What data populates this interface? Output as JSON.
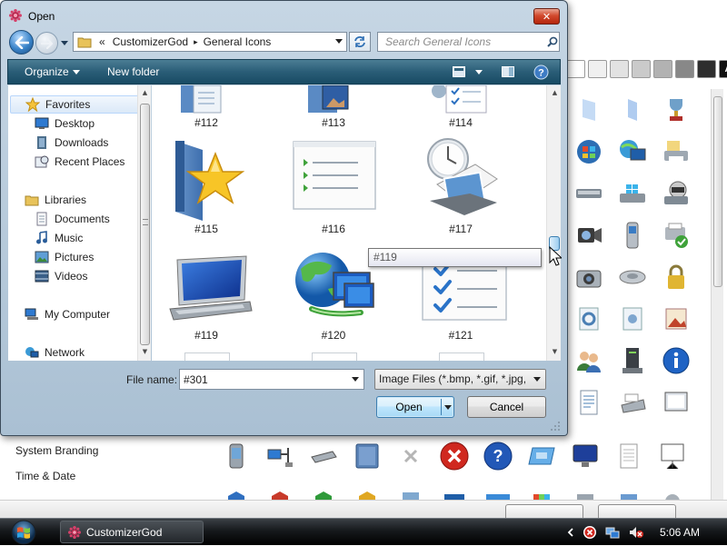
{
  "dialog": {
    "title": "Open",
    "close_label": "✕",
    "breadcrumb": {
      "overflow": "«",
      "parts": [
        "CustomizerGod",
        "General Icons"
      ],
      "separator": "▸"
    },
    "search": {
      "placeholder": "Search General Icons"
    },
    "toolbar": {
      "organize": "Organize",
      "new_folder": "New folder",
      "help": "?"
    },
    "nav": {
      "favorites": "Favorites",
      "desktop": "Desktop",
      "downloads": "Downloads",
      "recent_places": "Recent Places",
      "libraries": "Libraries",
      "documents": "Documents",
      "music": "Music",
      "pictures": "Pictures",
      "videos": "Videos",
      "my_computer": "My Computer",
      "network": "Network"
    },
    "files": [
      "#112",
      "#113",
      "#114",
      "#115",
      "#116",
      "#117",
      "#119",
      "#120",
      "#121"
    ],
    "tooltip": "#119",
    "file_name_label": "File name:",
    "file_name_value": "#301",
    "file_type": "Image Files (*.bmp, *.gif, *.jpg, ",
    "open_label": "Open",
    "cancel_label": "Cancel"
  },
  "background": {
    "swatch_letter": "A",
    "left_items": [
      "System Branding",
      "Time & Date"
    ],
    "swatch_colors": [
      "#ffffff",
      "#f2f2f2",
      "#e6e6e6",
      "#cfcfcf",
      "#b5b5b5",
      "#8c8c8c",
      "#3a3a3a",
      "#111111",
      "#000000"
    ]
  },
  "taskbar": {
    "app_button": "CustomizerGod",
    "time": "5:06 AM"
  },
  "colors": {
    "toolbar": "#2a5d77",
    "accent_blue": "#3c7fb1",
    "close_red": "#c8391d"
  }
}
